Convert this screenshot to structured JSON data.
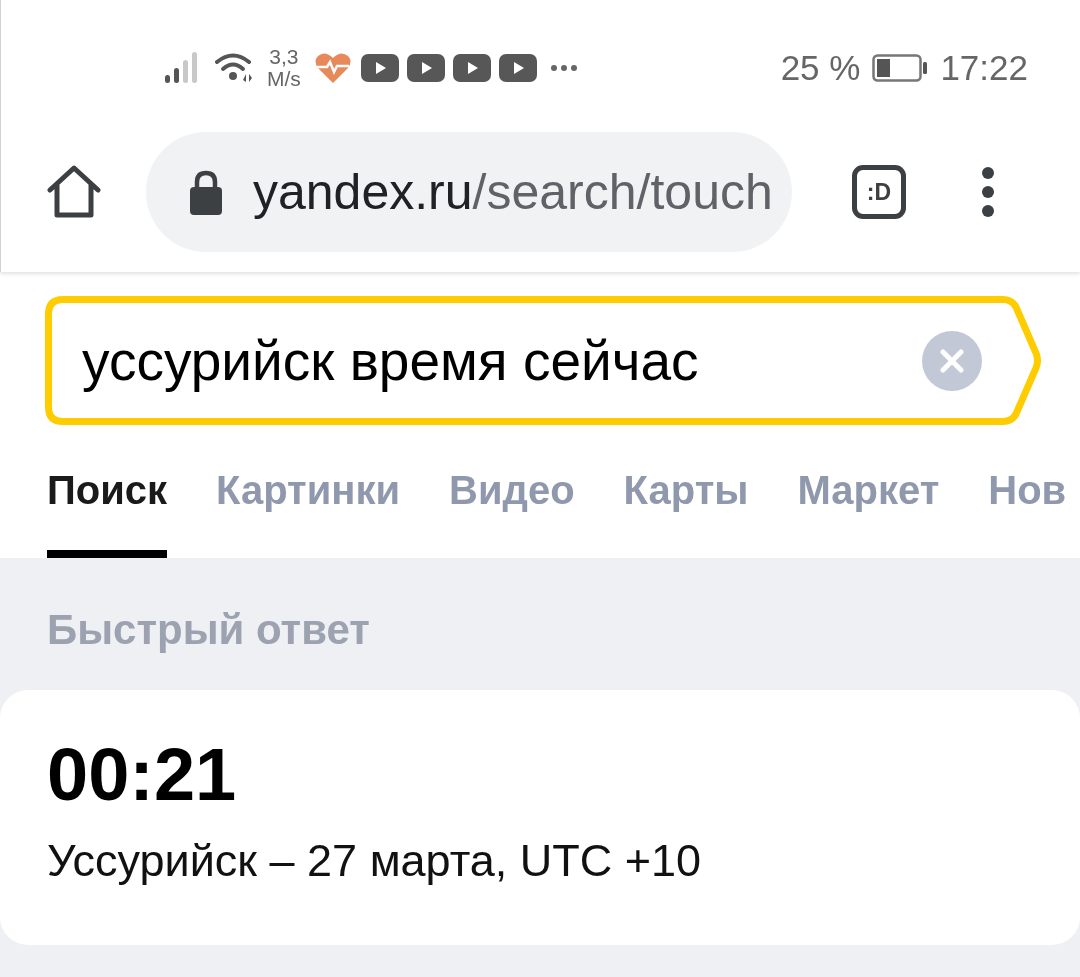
{
  "status_bar": {
    "speed_value": "3,3",
    "speed_unit": "M/s",
    "battery_percent": "25 %",
    "time": "17:22"
  },
  "browser": {
    "url_host": "yandex.ru",
    "url_path": "/search/touch",
    "tab_count": ":D"
  },
  "search": {
    "value": "уссурийск время сейчас"
  },
  "tabs": [
    {
      "label": "Поиск",
      "selected": true
    },
    {
      "label": "Картинки",
      "selected": false
    },
    {
      "label": "Видео",
      "selected": false
    },
    {
      "label": "Карты",
      "selected": false
    },
    {
      "label": "Маркет",
      "selected": false
    },
    {
      "label": "Нов",
      "selected": false
    }
  ],
  "quick_answer": {
    "heading": "Быстрый ответ",
    "time": "00:21",
    "details": "Уссурийск – 27 марта, UTC +10"
  }
}
